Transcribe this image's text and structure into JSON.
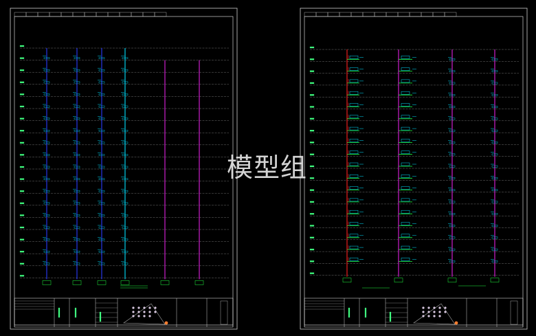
{
  "watermark": {
    "text": "模型组"
  },
  "colors": {
    "background": "#000000",
    "frame": "#d0d0d0",
    "grid": "#7a7a7a",
    "pipe_blue": "#2a3cff",
    "pipe_cyan": "#00e0ff",
    "pipe_magenta": "#e020e0",
    "pipe_red": "#ff2020",
    "pipe_green": "#20ff40",
    "pipe_yellow": "#ffff00",
    "text_label": "#40ff80"
  },
  "sheets": [
    {
      "name": "left-sheet",
      "floors": 18,
      "risers": [
        {
          "color": "pipe_blue",
          "detail": "simple"
        },
        {
          "color": "pipe_blue",
          "detail": "simple"
        },
        {
          "color": "pipe_blue",
          "detail": "simple"
        },
        {
          "color": "pipe_cyan",
          "detail": "simple"
        },
        {
          "color": "pipe_magenta",
          "detail": "none"
        },
        {
          "color": "pipe_magenta",
          "detail": "none"
        }
      ]
    },
    {
      "name": "right-sheet",
      "floors": 18,
      "risers": [
        {
          "color": "pipe_red",
          "detail": "branch"
        },
        {
          "color": "pipe_magenta",
          "detail": "branch"
        },
        {
          "color": "pipe_magenta",
          "detail": "simple"
        },
        {
          "color": "pipe_magenta",
          "detail": "simple"
        }
      ]
    }
  ]
}
